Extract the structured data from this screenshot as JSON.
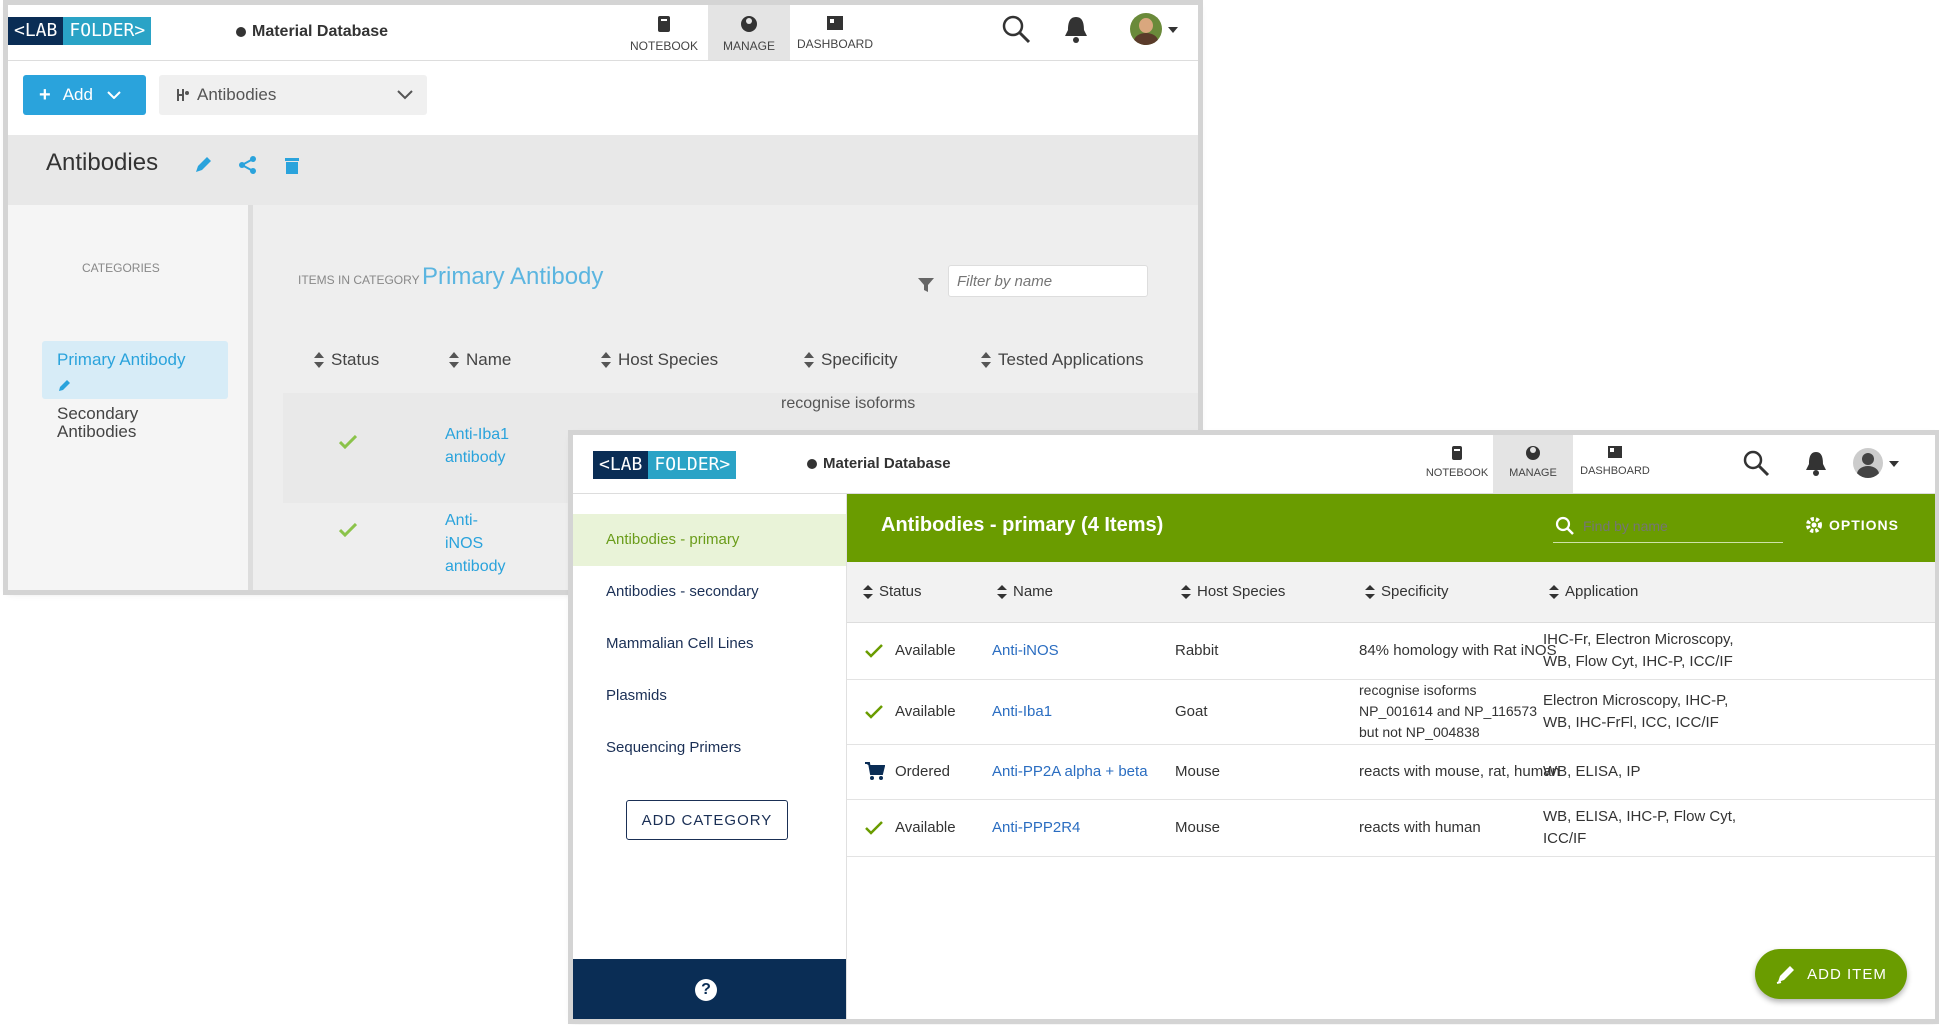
{
  "back_window": {
    "logo": {
      "left": "<LAB",
      "right": "FOLDER>"
    },
    "db_label": "Material Database",
    "nav": [
      {
        "label": "NOTEBOOK",
        "icon": "notebook-icon"
      },
      {
        "label": "MANAGE",
        "icon": "manage-icon"
      },
      {
        "label": "DASHBOARD",
        "icon": "dashboard-icon"
      }
    ],
    "add_label": "Add",
    "collection_select": "Antibodies",
    "title": "Antibodies",
    "categories_header": "CATEGORIES",
    "categories": [
      {
        "label": "Primary Antibody"
      },
      {
        "label": "Secondary Antibodies"
      }
    ],
    "items_in_category_label": "ITEMS IN CATEGORY",
    "category_name": "Primary Antibody",
    "filter_placeholder": "Filter by name",
    "columns": [
      "Status",
      "Name",
      "Host Species",
      "Specificity",
      "Tested Applications"
    ],
    "partial_specificity": "recognise isoforms",
    "rows": [
      {
        "name": "Anti-Iba1 antibody"
      },
      {
        "name": "Anti-iNOS antibody"
      }
    ]
  },
  "front_window": {
    "logo": {
      "left": "<LAB",
      "right": "FOLDER>"
    },
    "db_label": "Material Database",
    "nav": [
      {
        "label": "NOTEBOOK",
        "icon": "notebook-icon"
      },
      {
        "label": "MANAGE",
        "icon": "manage-icon"
      },
      {
        "label": "DASHBOARD",
        "icon": "dashboard-icon"
      }
    ],
    "sidebar": [
      {
        "label": "Antibodies - primary",
        "active": true
      },
      {
        "label": "Antibodies - secondary"
      },
      {
        "label": "Mammalian Cell Lines"
      },
      {
        "label": "Plasmids"
      },
      {
        "label": "Sequencing Primers"
      }
    ],
    "add_category": "ADD CATEGORY",
    "header_title": "Antibodies - primary (4 Items)",
    "search_placeholder": "Find by name",
    "options_label": "OPTIONS",
    "columns": [
      "Status",
      "Name",
      "Host Species",
      "Specificity",
      "Application"
    ],
    "rows": [
      {
        "status_icon": "check-icon",
        "status": "Available",
        "name": "Anti-iNOS",
        "host": "Rabbit",
        "specificity": [
          "84% homology with Rat iNOS"
        ],
        "application": [
          "IHC-Fr, Electron Microscopy,",
          "WB, Flow Cyt, IHC-P, ICC/IF"
        ]
      },
      {
        "status_icon": "check-icon",
        "status": "Available",
        "name": "Anti-Iba1",
        "host": "Goat",
        "specificity": [
          "recognise isoforms",
          "NP_001614 and NP_116573",
          "but not NP_004838"
        ],
        "application": [
          "Electron Microscopy, IHC-P,",
          "WB, IHC-FrFl, ICC, ICC/IF"
        ]
      },
      {
        "status_icon": "cart-icon",
        "status": "Ordered",
        "name": "Anti-PP2A alpha + beta",
        "host": "Mouse",
        "specificity": [
          "reacts with mouse, rat, human"
        ],
        "application": [
          "WB, ELISA, IP"
        ]
      },
      {
        "status_icon": "check-icon",
        "status": "Available",
        "name": "Anti-PPP2R4",
        "host": "Mouse",
        "specificity": [
          "reacts with human"
        ],
        "application": [
          "WB, ELISA, IHC-P, Flow Cyt,",
          "ICC/IF"
        ]
      }
    ],
    "add_item": "ADD ITEM",
    "help_icon": "question-icon"
  },
  "colors": {
    "brand_navy": "#0a2d55",
    "brand_cyan": "#2aa3c6",
    "green": "#6a9c00",
    "link_blue": "#2aa3dc"
  }
}
